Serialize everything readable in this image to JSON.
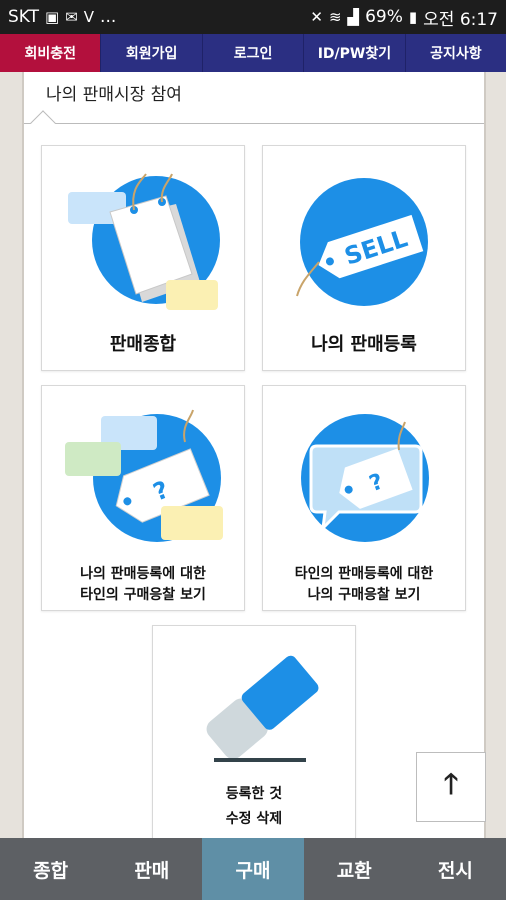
{
  "status_bar": {
    "carrier": "SKT",
    "left_icons": [
      "image-icon",
      "mail-icon",
      "v-app-icon"
    ],
    "ellipsis": "...",
    "battery": "69%",
    "time": "오전 6:17"
  },
  "top_nav": {
    "items": [
      "회비충전",
      "회원가입",
      "로그인",
      "ID/PW찾기",
      "공지사항"
    ],
    "active_index": 0
  },
  "section": {
    "title": "나의 판매시장 참여"
  },
  "cards": {
    "sales_summary": {
      "label": "판매종합",
      "icon": "price-tag-icon"
    },
    "my_sales_registration": {
      "label": "나의 판매등록",
      "icon": "sell-tag-icon",
      "tag_text": "SELL"
    },
    "view_bids_on_my_sales": {
      "line1": "나의 판매등록에 대한",
      "line2": "타인의 구매응찰 보기",
      "icon": "question-tag-icon",
      "tag_text": "?"
    },
    "view_my_bids_on_others": {
      "line1": "타인의 판매등록에 대한",
      "line2": "나의 구매응찰 보기",
      "icon": "question-chat-icon",
      "tag_text": "?"
    },
    "edit_delete": {
      "line1": "등록한 것",
      "line2": "수정 삭제",
      "icon": "eraser-icon"
    }
  },
  "scroll_top": {
    "icon": "arrow-up-icon",
    "glyph": "🡑"
  },
  "bottom_nav": {
    "tabs": [
      "종합",
      "판매",
      "구매",
      "교환",
      "전시"
    ],
    "active_index": 2
  },
  "colors": {
    "status_bar": "#1d1d1d",
    "top_nav": "#2b2f82",
    "top_nav_active": "#b3103d",
    "icon_blue": "#1d8fe6",
    "bottom_nav": "#5d6064",
    "bottom_nav_active": "#5f8fa6"
  }
}
